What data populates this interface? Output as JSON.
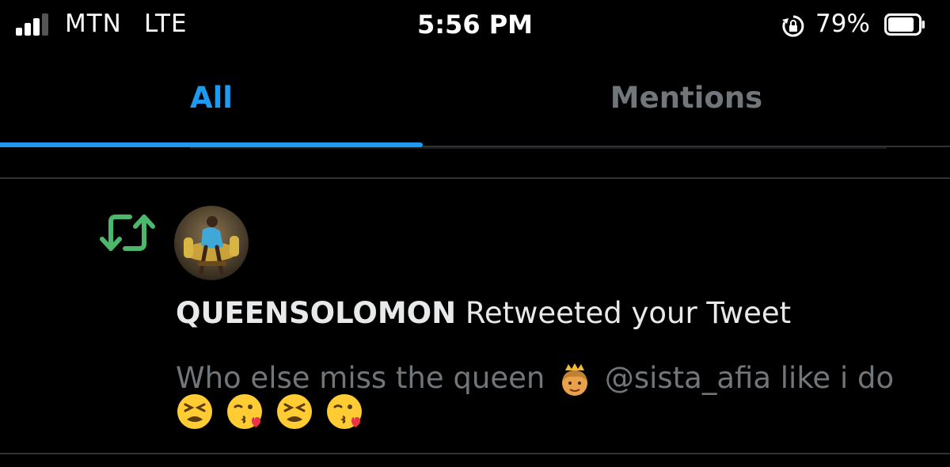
{
  "status_bar": {
    "carrier": "MTN",
    "network": "LTE",
    "time": "5:56 PM",
    "battery_percent": "79%",
    "icons": [
      "signal-icon",
      "rotation-lock-icon",
      "battery-icon"
    ]
  },
  "tabs": [
    {
      "label": "All",
      "active": true
    },
    {
      "label": "Mentions",
      "active": false
    }
  ],
  "colors": {
    "accent": "#1d9bf0",
    "retweet": "#4cb86b",
    "muted": "#71767b",
    "background": "#000000"
  },
  "notification": {
    "icon": "retweet-icon",
    "username": "QUEENSOLOMON",
    "action": " Retweeted your Tweet",
    "tweet_text_before": "Who else miss the queen ",
    "tweet_emoji": "princess-emoji",
    "tweet_text_after": " @sista_afia like i do",
    "emojis": [
      "tired-face-emoji",
      "face-blowing-kiss-emoji",
      "tired-face-emoji",
      "face-blowing-kiss-emoji"
    ]
  }
}
